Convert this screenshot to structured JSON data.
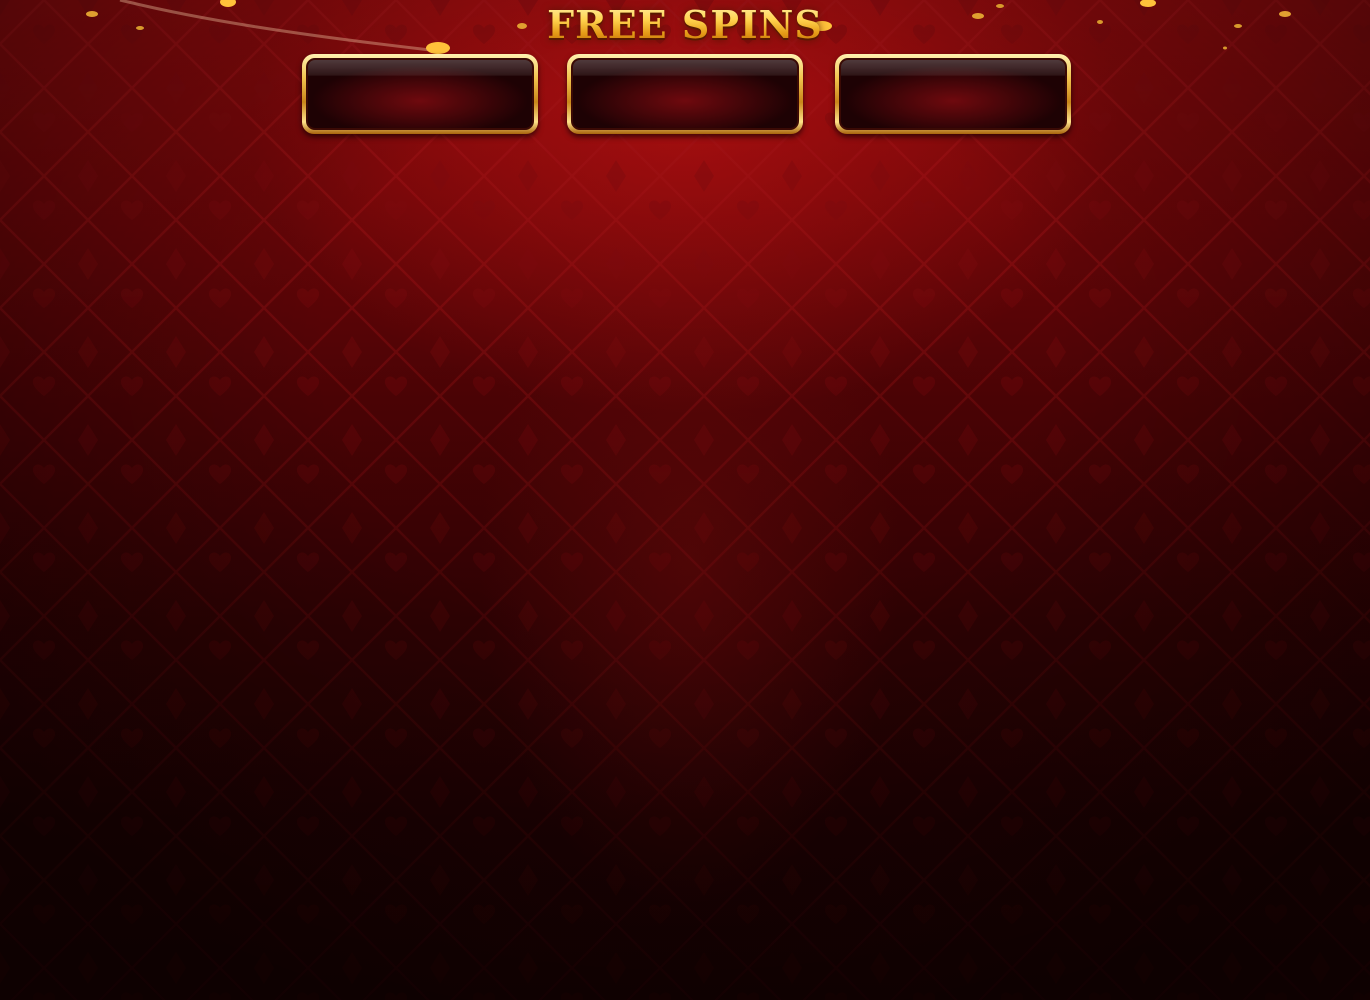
{
  "game": {
    "title": "FREE SPINS",
    "counters": [
      {
        "value": ""
      },
      {
        "value": ""
      },
      {
        "value": ""
      }
    ]
  },
  "theme": {
    "background": "#6e0608",
    "accent_gold": "#ffd24d",
    "pattern_symbols": [
      "heart",
      "club",
      "spade",
      "diamond"
    ]
  }
}
